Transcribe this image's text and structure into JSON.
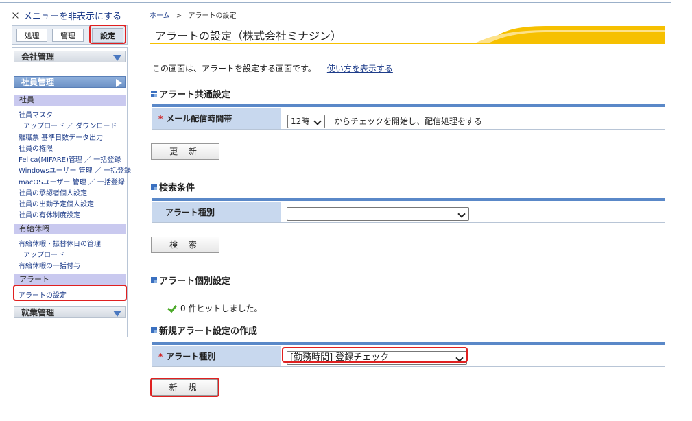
{
  "sidebar": {
    "hide_menu": "メニューを非表示にする",
    "tabs": [
      "処理",
      "管理",
      "設定"
    ],
    "company_mgmt": "会社管理",
    "employee_mgmt": "社員管理",
    "groups": {
      "employee": "社員",
      "paid_leave": "有給休暇",
      "alert": "アラート"
    },
    "employee_links": [
      "社員マスタ",
      "アップロード ／ ダウンロード",
      "離職票 基準日数データ出力",
      "社員の権限",
      "Felica(MIFARE)管理 ／ 一括登録",
      "Windowsユーザー 管理 ／ 一括登録",
      "macOSユーザー 管理 ／ 一括登録",
      "社員の承認者個人設定",
      "社員の出勤予定個人設定",
      "社員の有休制度設定"
    ],
    "leave_links": [
      "有給休暇・振替休日の管理",
      "アップロード",
      "有給休暇の一括付与"
    ],
    "alert_links": [
      "アラートの設定"
    ],
    "work_mgmt": "就業管理"
  },
  "breadcrumb": {
    "home": "ホーム",
    "sep": ">",
    "current": "アラートの設定"
  },
  "page_title": "アラートの設定（株式会社ミナジン）",
  "intro": {
    "text": "この画面は、アラートを設定する画面です。",
    "help_link": "使い方を表示する"
  },
  "common": {
    "heading": "アラート共通設定",
    "label": "メール配信時間帯",
    "select_value": "12時",
    "suffix": "からチェックを開始し、配信処理をする",
    "button": "更 新"
  },
  "search": {
    "heading": "検索条件",
    "label": "アラート種別",
    "select_value": "",
    "button": "検 索"
  },
  "individual": {
    "heading": "アラート個別設定",
    "hits": "0 件ヒットしました。"
  },
  "new_setting": {
    "heading": "新規アラート設定の作成",
    "label": "アラート種別",
    "select_value": "[勤務時間] 登録チェック",
    "button": "新 規"
  },
  "required_mark": "*",
  "colors": {
    "highlight": "#e02020",
    "accent": "#f6c000",
    "table_header": "#c8d8ee"
  }
}
